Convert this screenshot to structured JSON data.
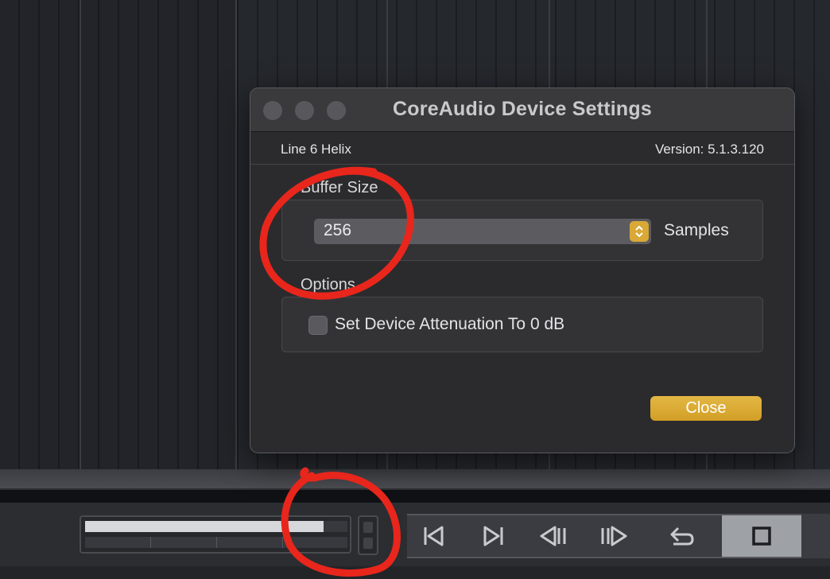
{
  "dialog": {
    "title": "CoreAudio Device Settings",
    "device_name": "Line 6 Helix",
    "version": "Version: 5.1.3.120",
    "buffer_group": {
      "label": "Buffer Size",
      "value": "256",
      "unit": "Samples"
    },
    "options_group": {
      "label": "Options",
      "checkbox_label": "Set Device Attenuation To 0 dB",
      "checked": false
    },
    "close_label": "Close"
  },
  "transport": {
    "meter_level": 0.91,
    "buttons": [
      "rewind-to-start-icon",
      "skip-forward-icon",
      "step-back-icon",
      "step-forward-icon",
      "loop-icon",
      "stop-icon"
    ]
  },
  "colors": {
    "accent": "#d9a836",
    "annotation": "#e8261c",
    "dialog_bg": "#2b2b2d"
  }
}
